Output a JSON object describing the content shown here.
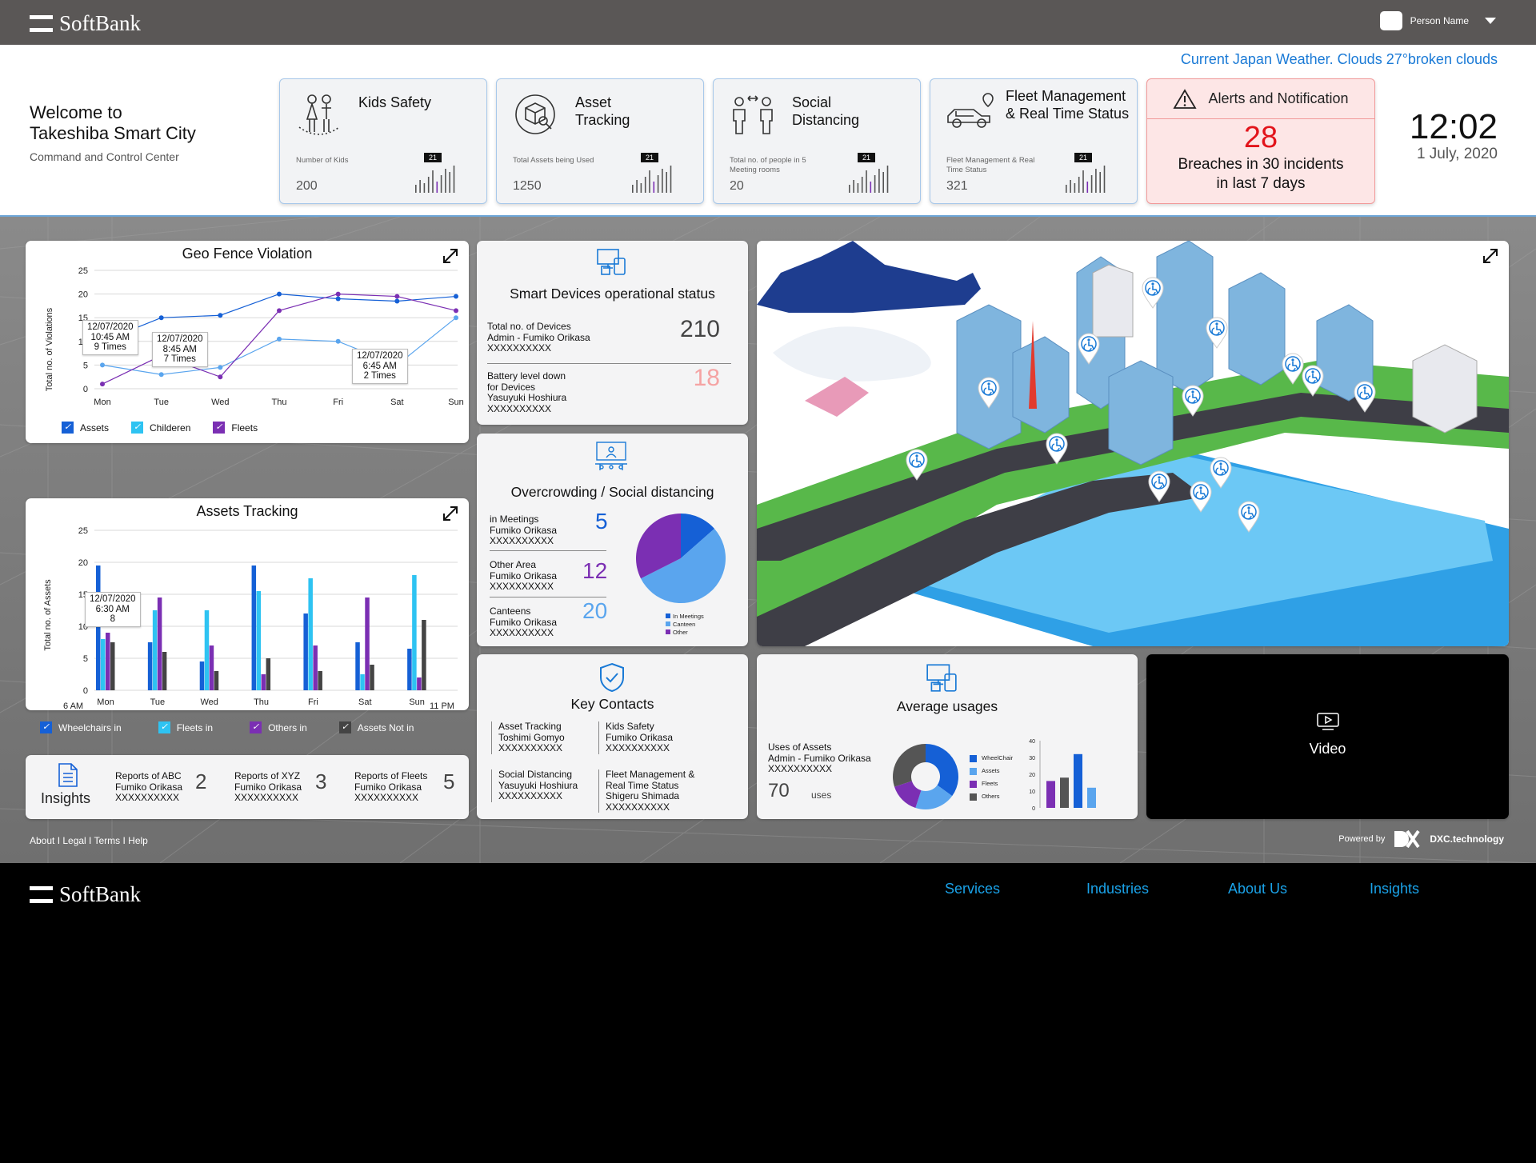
{
  "brand": "SoftBank",
  "user": {
    "name": "Person Name"
  },
  "weather": "Current Japan Weather. Clouds 27°broken clouds",
  "welcome": {
    "line1": "Welcome to",
    "line2": "Takeshiba Smart City",
    "subtitle": "Command and Control Center"
  },
  "kpis": [
    {
      "title1": "Kids Safety",
      "title2": "",
      "label": "Number of Kids",
      "value": "200",
      "badge": "21",
      "icon": "kids-icon"
    },
    {
      "title1": "Asset",
      "title2": "Tracking",
      "label": "Total Assets being Used",
      "value": "1250",
      "badge": "21",
      "icon": "box-icon"
    },
    {
      "title1": "Social",
      "title2": "Distancing",
      "label": "Total no. of people in 5 Meeting rooms",
      "value": "20",
      "badge": "21",
      "icon": "people-distance-icon"
    },
    {
      "title1": "Fleet Management",
      "title2": "& Real Time Status",
      "label": "Fleet Management & Real Time Status",
      "value": "321",
      "badge": "21",
      "icon": "car-icon"
    }
  ],
  "alert": {
    "title": "Alerts and Notification",
    "count": "28",
    "line1": "Breaches in 30 incidents",
    "line2": "in last 7 days"
  },
  "clock": {
    "time": "12:02",
    "date": "1 July, 2020"
  },
  "geo": {
    "title": "Geo Fence Violation",
    "ylabel": "Total no. of Violations",
    "tips": [
      {
        "d": "12/07/2020",
        "t": "10:45 AM",
        "n": "9 Times"
      },
      {
        "d": "12/07/2020",
        "t": "8:45 AM",
        "n": "7 Times"
      },
      {
        "d": "12/07/2020",
        "t": "6:45 AM",
        "n": "2 Times"
      }
    ],
    "legend": [
      "Assets",
      "Childeren",
      "Fleets"
    ]
  },
  "assets": {
    "title": "Assets Tracking",
    "ylabel": "Total no. of Assets",
    "start": "6 AM",
    "end": "11 PM",
    "tip": {
      "d": "12/07/2020",
      "t": "6:30 AM",
      "n": "8"
    },
    "legend": [
      "Wheelchairs in",
      "Fleets in",
      "Others in",
      "Assets Not in"
    ]
  },
  "smart": {
    "title": "Smart Devices operational status",
    "r1": {
      "l1": "Total no. of Devices",
      "l2": "Admin - Fumiko Orikasa",
      "l3": "XXXXXXXXXX",
      "v": "210"
    },
    "r2": {
      "l1": "Battery level down",
      "l2": "for Devices",
      "l3": "Yasuyuki Hoshiura",
      "l4": "XXXXXXXXXX",
      "v": "18"
    }
  },
  "crowd": {
    "title": "Overcrowding / Social distancing",
    "rows": [
      {
        "l1": "in Meetings",
        "l2": "Fumiko Orikasa",
        "l3": "XXXXXXXXXX",
        "v": "5"
      },
      {
        "l1": "Other Area",
        "l2": "Fumiko Orikasa",
        "l3": "XXXXXXXXXX",
        "v": "12"
      },
      {
        "l1": "Canteens",
        "l2": "Fumiko Orikasa",
        "l3": "XXXXXXXXXX",
        "v": "20"
      }
    ],
    "legend": [
      "In Meetings",
      "Canteen",
      "Other"
    ]
  },
  "contacts": {
    "title": "Key Contacts",
    "c": [
      {
        "l1": "Asset Tracking",
        "l2": "Toshimi Gomyo",
        "l3": "XXXXXXXXXX"
      },
      {
        "l1": "Kids Safety",
        "l2": "Fumiko Orikasa",
        "l3": "XXXXXXXXXX"
      },
      {
        "l1": "Social Distancing",
        "l2": "Yasuyuki Hoshiura",
        "l3": "XXXXXXXXXX"
      },
      {
        "l1": "Fleet Management &",
        "l2": "Real Time Status",
        "l3": "Shigeru Shimada",
        "l4": "XXXXXXXXXX"
      }
    ]
  },
  "usage": {
    "title": "Average usages",
    "l1": "Uses of  Assets",
    "l2": "Admin - Fumiko Orikasa",
    "l3": "XXXXXXXXXX",
    "v": "70",
    "unit": "uses",
    "legend": [
      "WheelChair",
      "Assets",
      "Fleets",
      "Others"
    ]
  },
  "insights": {
    "title": "Insights",
    "r": [
      {
        "l1": "Reports of ABC",
        "l2": "Fumiko Orikasa",
        "l3": "XXXXXXXXXX",
        "v": "2"
      },
      {
        "l1": "Reports of XYZ",
        "l2": "Fumiko Orikasa",
        "l3": "XXXXXXXXXX",
        "v": "3"
      },
      {
        "l1": "Reports of Fleets",
        "l2": "Fumiko Orikasa",
        "l3": "XXXXXXXXXX",
        "v": "5"
      }
    ]
  },
  "video": {
    "label": "Video"
  },
  "footlinks": "About I Legal I Terms I Help",
  "powered": {
    "label": "Powered by",
    "brand": "DXC.technology"
  },
  "footer_nav": [
    "Services",
    "Industries",
    "About Us",
    "Insights"
  ],
  "colors": {
    "blue": "#1560d6",
    "cyan": "#2ec3f2",
    "purple": "#7b2fb3",
    "gray": "#444444",
    "alert_red": "#e2141b",
    "accent": "#1a7ad6"
  },
  "chart_data": [
    {
      "type": "line",
      "title": "Geo Fence Violation",
      "ylabel": "Total no. of Violations",
      "xlabel": "",
      "categories": [
        "Mon",
        "Tue",
        "Wed",
        "Thu",
        "Fri",
        "Sat",
        "Sun"
      ],
      "ylim": [
        0,
        25
      ],
      "yticks": [
        0,
        5,
        10,
        15,
        20,
        25
      ],
      "series": [
        {
          "name": "Assets",
          "values": [
            10,
            15,
            15.5,
            20,
            19,
            18.5,
            19.5
          ]
        },
        {
          "name": "Childeren",
          "values": [
            5,
            3,
            4.5,
            10.5,
            10,
            5,
            15
          ]
        },
        {
          "name": "Fleets",
          "values": [
            1,
            7,
            2.5,
            16.5,
            20,
            19.5,
            16.5
          ]
        }
      ]
    },
    {
      "type": "bar",
      "title": "Assets Tracking",
      "ylabel": "Total no. of Assets",
      "categories": [
        "Mon",
        "Tue",
        "Wed",
        "Thu",
        "Fri",
        "Sat",
        "Sun"
      ],
      "ylim": [
        0,
        25
      ],
      "yticks": [
        0,
        5,
        10,
        15,
        20,
        25
      ],
      "series": [
        {
          "name": "Wheelchairs in",
          "values": [
            19.5,
            7.5,
            4.5,
            19.5,
            12,
            7.5,
            6.5
          ]
        },
        {
          "name": "Fleets in",
          "values": [
            8,
            12.5,
            12.5,
            15.5,
            17.5,
            2.5,
            18
          ]
        },
        {
          "name": "Others in",
          "values": [
            9,
            14.5,
            7,
            2.5,
            7,
            14.5,
            2
          ]
        },
        {
          "name": "Assets Not in",
          "values": [
            7.5,
            6,
            3,
            5,
            3,
            4,
            11
          ]
        }
      ]
    },
    {
      "type": "pie",
      "categories": [
        "In Meetings",
        "Canteen",
        "Other"
      ],
      "values": [
        5,
        20,
        12
      ]
    },
    {
      "type": "pie",
      "categories": [
        "WheelChair",
        "Assets",
        "Fleets",
        "Others"
      ],
      "values": [
        35,
        20,
        15,
        30
      ]
    },
    {
      "type": "bar",
      "categories": [
        "WheelChair",
        "Others",
        "Fleets",
        "Assets"
      ],
      "values": [
        16,
        18,
        32,
        12
      ],
      "ylim": [
        0,
        40
      ],
      "yticks": [
        0,
        10,
        20,
        30,
        40
      ]
    }
  ]
}
